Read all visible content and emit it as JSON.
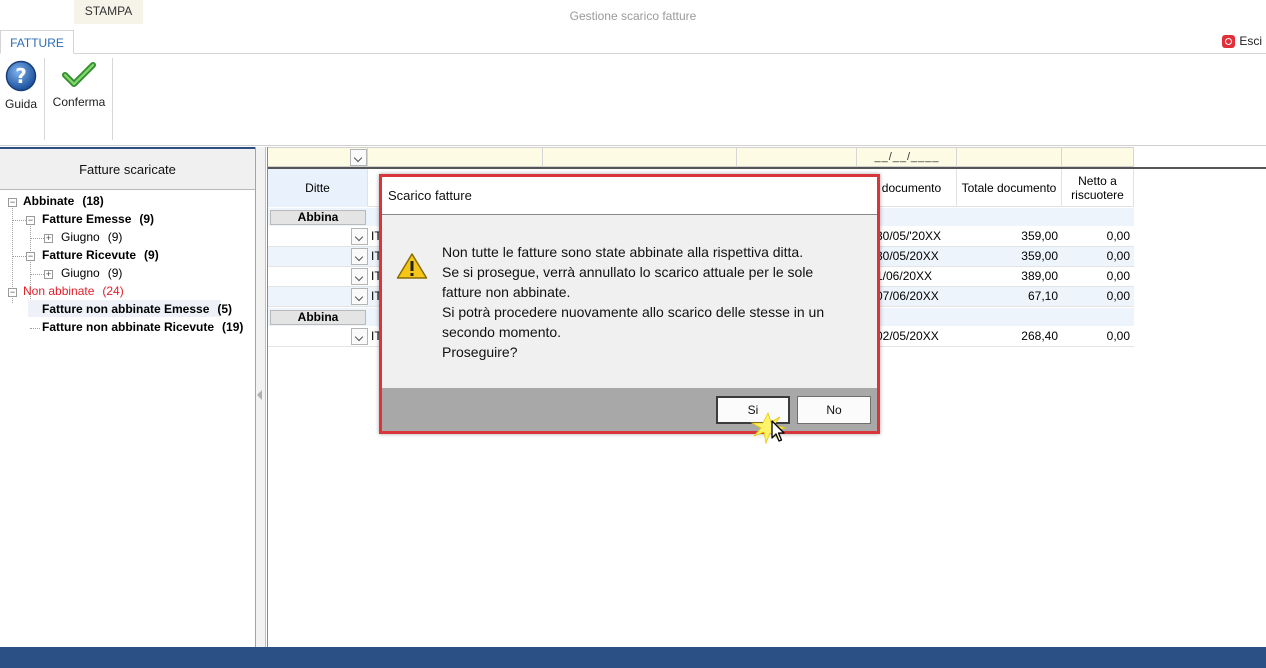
{
  "window": {
    "title": "Gestione scarico fatture"
  },
  "tabs": {
    "fatture": "FATTURE",
    "stampa": "STAMPA",
    "esci": "Esci"
  },
  "ribbon": {
    "guida": "Guida",
    "conferma": "Conferma"
  },
  "left_panel": {
    "header": "Fatture scaricate",
    "tree": {
      "abbinate": {
        "label": "Abbinate",
        "count": "(18)"
      },
      "fatture_emesse": {
        "label": "Fatture Emesse",
        "count": "(9)"
      },
      "giugno_emesse": {
        "label": "Giugno",
        "count": "(9)"
      },
      "fatture_ricevute": {
        "label": "Fatture Ricevute",
        "count": "(9)"
      },
      "giugno_ricevute": {
        "label": "Giugno",
        "count": "(9)"
      },
      "non_abbinate": {
        "label": "Non abbinate",
        "count": "(24)"
      },
      "non_abbinate_emesse": {
        "label": "Fatture non abbinate Emesse",
        "count": "(5)"
      },
      "non_abbinate_ricevute": {
        "label": "Fatture non abbinate Ricevute",
        "count": "(19)"
      }
    }
  },
  "grid": {
    "date_filter": "__/__/____",
    "headers": {
      "ditte": "Ditte",
      "data_documento": "a documento",
      "totale": "Totale documento",
      "netto": "Netto a riscuotere"
    },
    "abbina_label": "Abbina",
    "rows": [
      {
        "code": "IT",
        "date": "30/05/'20XX",
        "totale": "359,00",
        "netto": "0,00"
      },
      {
        "code": "IT",
        "date": "30/05/20XX",
        "totale": "359,00",
        "netto": "0,00"
      },
      {
        "code": "IT",
        "date": "1/06/20XX",
        "totale": "389,00",
        "netto": "0,00"
      },
      {
        "code": "IT",
        "date": "07/06/20XX",
        "totale": "67,10",
        "netto": "0,00"
      }
    ],
    "rows2": [
      {
        "code": "IT",
        "date": "02/05/20XX",
        "totale": "268,40",
        "netto": "0,00"
      }
    ]
  },
  "dialog": {
    "title": "Scarico fatture",
    "lines": [
      "Non tutte le fatture sono state abbinate alla rispettiva ditta.",
      "Se si prosegue, verrà annullato lo scarico attuale per le sole",
      "fatture non abbinate.",
      "Si potrà procedere nuovamente allo scarico delle stesse in un",
      "secondo momento.",
      "Proseguire?"
    ],
    "yes": "Si",
    "no": "No"
  },
  "colors": {
    "accent_blue": "#2b6cb5",
    "status_bar": "#2b5086",
    "dialog_border": "#d9363b",
    "non_abbinate_red": "#e0202a",
    "stampa_accent": "#f5a623"
  },
  "icons": [
    "help-icon",
    "checkmark-icon",
    "exit-icon",
    "warning-icon",
    "mouse-cursor-icon"
  ]
}
